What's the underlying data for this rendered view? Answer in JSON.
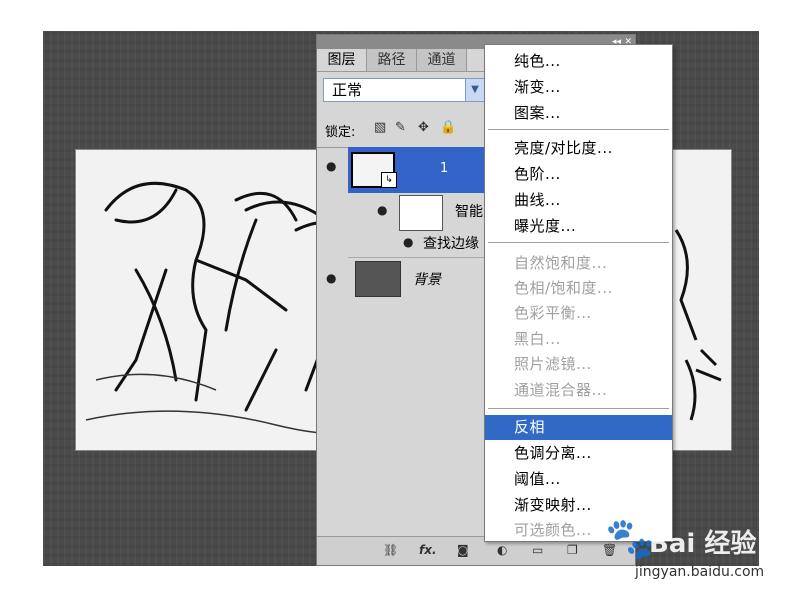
{
  "panel": {
    "tabs": [
      "图层",
      "路径",
      "通道"
    ],
    "blend_mode": "正常",
    "lock_label": "锁定:",
    "layers": {
      "layer1_name": "1",
      "smart_filters_label": "智能",
      "filter_name": "查找边缘",
      "background_name": "背景"
    },
    "bottom_icons": [
      "link-icon",
      "fx-icon",
      "mask-icon",
      "adjustment-icon",
      "group-icon",
      "new-layer-icon",
      "trash-icon"
    ],
    "fx_label": "fx."
  },
  "adjustment_menu": {
    "items": [
      {
        "label": "纯色...",
        "enabled": true
      },
      {
        "label": "渐变...",
        "enabled": true
      },
      {
        "label": "图案...",
        "enabled": true
      },
      {
        "label": "亮度/对比度...",
        "enabled": true
      },
      {
        "label": "色阶...",
        "enabled": true
      },
      {
        "label": "曲线...",
        "enabled": true
      },
      {
        "label": "曝光度...",
        "enabled": true
      },
      {
        "label": "自然饱和度...",
        "enabled": false
      },
      {
        "label": "色相/饱和度...",
        "enabled": false
      },
      {
        "label": "色彩平衡...",
        "enabled": false
      },
      {
        "label": "黑白...",
        "enabled": false
      },
      {
        "label": "照片滤镜...",
        "enabled": false
      },
      {
        "label": "通道混合器...",
        "enabled": false
      },
      {
        "label": "反相",
        "enabled": true,
        "highlighted": true
      },
      {
        "label": "色调分离...",
        "enabled": true
      },
      {
        "label": "阈值...",
        "enabled": true
      },
      {
        "label": "渐变映射...",
        "enabled": true
      },
      {
        "label": "可选颜色...",
        "enabled": false
      }
    ]
  },
  "watermark": {
    "brand": "Bai 经验",
    "url": "jingyan.baidu.com"
  },
  "colors": {
    "highlight": "#3169c6",
    "selected_layer": "#3264c8",
    "disabled_text": "#a0a0a0"
  }
}
